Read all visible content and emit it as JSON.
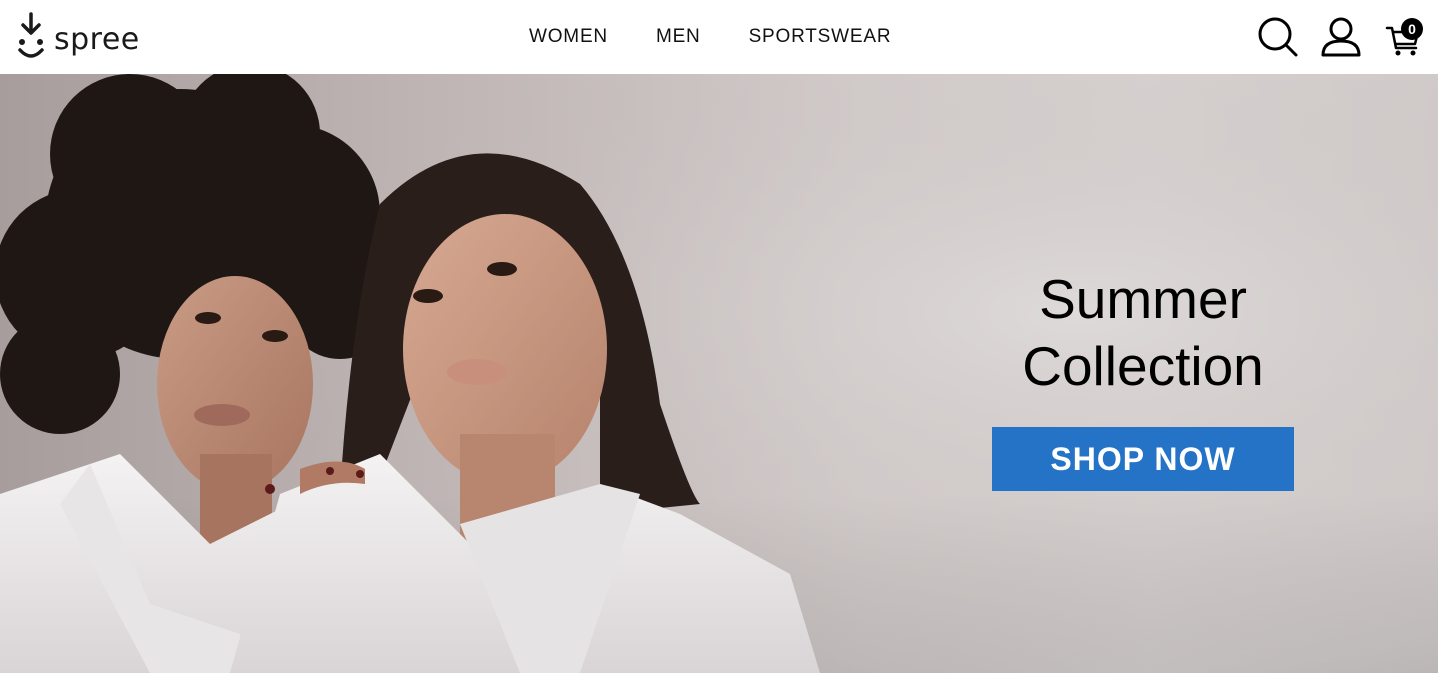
{
  "header": {
    "logo_text": "spree",
    "nav": [
      {
        "label": "WOMEN"
      },
      {
        "label": "MEN"
      },
      {
        "label": "SPORTSWEAR"
      }
    ],
    "icons": {
      "search": "search-icon",
      "account": "user-icon",
      "cart": "cart-icon"
    },
    "cart_count": "0"
  },
  "hero": {
    "title_line1": "Summer",
    "title_line2": "Collection",
    "button_label": "SHOP NOW",
    "button_color": "#2473c7"
  }
}
